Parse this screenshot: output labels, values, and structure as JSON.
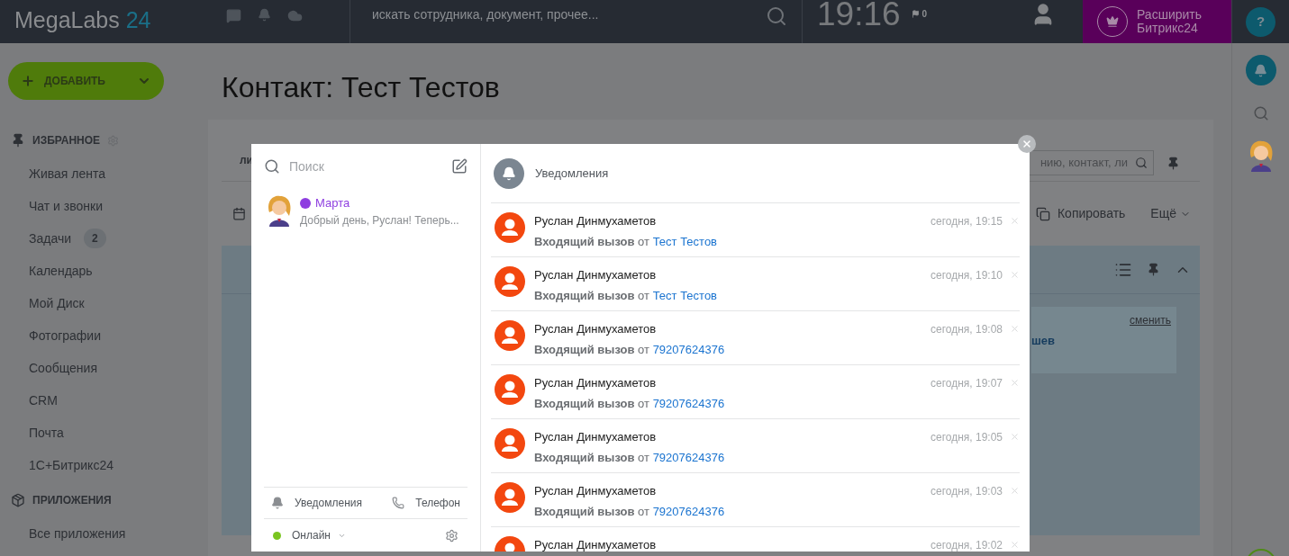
{
  "header": {
    "logo_name": "MegaLabs",
    "logo_number": "24",
    "search_placeholder": "искать сотрудника, документ, прочее...",
    "time": "19:16",
    "flag_count": "0",
    "upgrade_lines": [
      "Расширить",
      "Битрикс24"
    ],
    "help": "?"
  },
  "add_button": "ДОБАВИТЬ",
  "sidebar": {
    "favorites_title": "ИЗБРАННОЕ",
    "items": [
      {
        "label": "Живая лента"
      },
      {
        "label": "Чат и звонки"
      },
      {
        "label": "Задачи",
        "badge": "2"
      },
      {
        "label": "Календарь"
      },
      {
        "label": "Мой Диск"
      },
      {
        "label": "Фотографии"
      },
      {
        "label": "Сообщения"
      },
      {
        "label": "CRM"
      },
      {
        "label": "Почта"
      },
      {
        "label": "1С+Битрикс24"
      }
    ],
    "apps_title": "ПРИЛОЖЕНИЯ",
    "apps_items": [
      {
        "label": "Все приложения"
      }
    ]
  },
  "page_title": "Контакт: Тест Тестов",
  "background": {
    "tab_fragment": "ли",
    "search_fragment": "нию, контакт, ли",
    "copy_button": "Копировать",
    "more_button": "Ещё",
    "change_link": "сменить",
    "name_fragment": "шев"
  },
  "messenger": {
    "search_placeholder": "Поиск",
    "chats": [
      {
        "name": "Марта",
        "preview": "Добрый день, Руслан! Теперь..."
      }
    ],
    "bottom_tabs": [
      {
        "kind": "bell",
        "label": "Уведомления"
      },
      {
        "kind": "phone",
        "label": "Телефон"
      }
    ],
    "status": {
      "label": "Онлайн",
      "color": "#7ac520"
    }
  },
  "notifications": {
    "title": "Уведомления",
    "items": [
      {
        "author": "Руслан Динмухаметов",
        "time": "сегодня, 19:15",
        "action": "Входящий вызов",
        "from": "от",
        "link": "Тест Тестов"
      },
      {
        "author": "Руслан Динмухаметов",
        "time": "сегодня, 19:10",
        "action": "Входящий вызов",
        "from": "от",
        "link": "Тест Тестов"
      },
      {
        "author": "Руслан Динмухаметов",
        "time": "сегодня, 19:08",
        "action": "Входящий вызов",
        "from": "от",
        "link": "79207624376"
      },
      {
        "author": "Руслан Динмухаметов",
        "time": "сегодня, 19:07",
        "action": "Входящий вызов",
        "from": "от",
        "link": "79207624376"
      },
      {
        "author": "Руслан Динмухаметов",
        "time": "сегодня, 19:05",
        "action": "Входящий вызов",
        "from": "от",
        "link": "79207624376"
      },
      {
        "author": "Руслан Динмухаметов",
        "time": "сегодня, 19:03",
        "action": "Входящий вызов",
        "from": "от",
        "link": "79207624376"
      },
      {
        "author": "Руслан Динмухаметов",
        "time": "сегодня, 19:02"
      }
    ]
  }
}
